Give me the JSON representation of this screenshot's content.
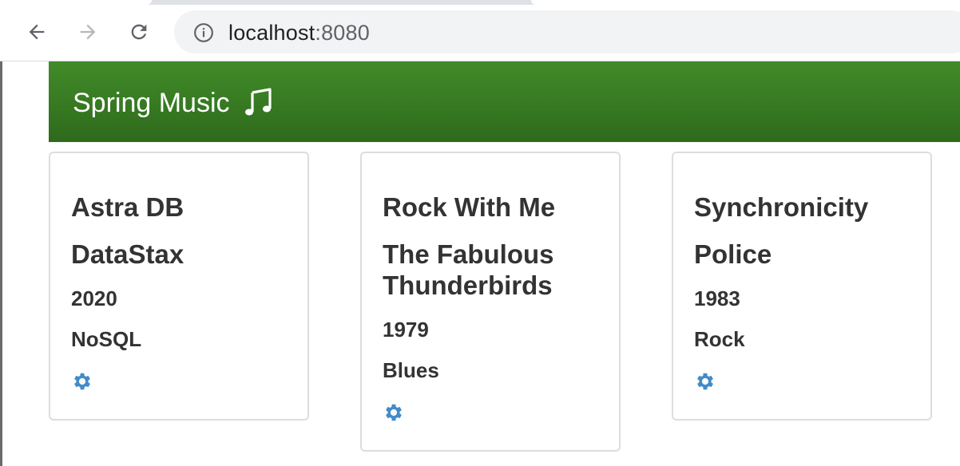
{
  "browser": {
    "url_host": "localhost",
    "url_port": ":8080",
    "icons": [
      "back-arrow-icon",
      "forward-arrow-icon",
      "reload-icon",
      "info-icon"
    ]
  },
  "app": {
    "brand": "Spring Music",
    "brand_icon": "music-note-icon",
    "navbar_color": "#3a7d24",
    "accent_color": "#428bca"
  },
  "albums": [
    {
      "title": "Astra DB",
      "artist": "DataStax",
      "year": "2020",
      "genre": "NoSQL"
    },
    {
      "title": "Rock With Me",
      "artist": "The Fabulous Thunderbirds",
      "year": "1979",
      "genre": "Blues"
    },
    {
      "title": "Synchronicity",
      "artist": "Police",
      "year": "1983",
      "genre": "Rock"
    }
  ]
}
